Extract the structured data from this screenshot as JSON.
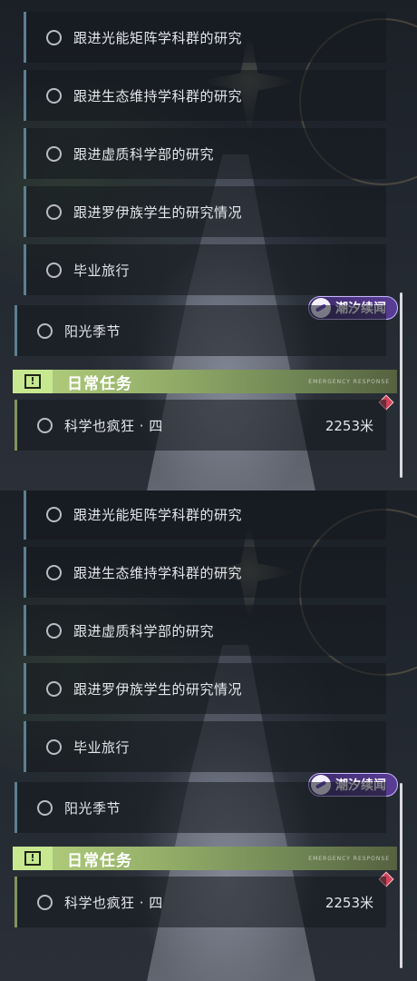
{
  "panels": [
    {
      "quests": [
        "跟进光能矩阵学科群的研究",
        "跟进生态维持学科群的研究",
        "跟进虚质科学部的研究",
        "跟进罗伊族学生的研究情况",
        "毕业旅行"
      ],
      "event_badge": "潮汐续闻",
      "season_quest": "阳光季节",
      "section_title": "日常任务",
      "section_deco": "EMERGENCY RESPONSE",
      "daily_quest": {
        "name": "科学也疯狂 · 四",
        "distance": "2253米"
      }
    },
    {
      "quests": [
        "跟进光能矩阵学科群的研究",
        "跟进生态维持学科群的研究",
        "跟进虚质科学部的研究",
        "跟进罗伊族学生的研究情况",
        "毕业旅行"
      ],
      "event_badge": "潮汐续闻",
      "season_quest": "阳光季节",
      "section_title": "日常任务",
      "section_deco": "EMERGENCY RESPONSE",
      "daily_quest": {
        "name": "科学也疯狂 · 四",
        "distance": "2253米"
      }
    }
  ],
  "colors": {
    "header_green": "#b6d37e",
    "badge_purple": "#5a3d96",
    "marker_red": "#d0435a",
    "quest_border": "#5d7f90"
  },
  "icons": [
    "quest-status-icon",
    "alert-icon",
    "event-icon",
    "waypoint-icon"
  ]
}
